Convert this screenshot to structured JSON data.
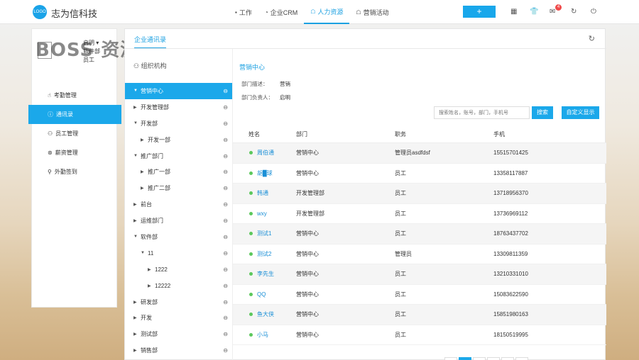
{
  "app": {
    "logo_text": "LOGO",
    "brand": "志为信科技",
    "watermark": "BOSS 资源"
  },
  "nav": [
    {
      "label": "工作",
      "icon": "briefcase-icon",
      "glyph": "▪"
    },
    {
      "label": "企业CRM",
      "icon": "pie-chart-icon",
      "glyph": "◔"
    },
    {
      "label": "人力资源",
      "icon": "people-icon",
      "glyph": "☖",
      "active": true
    },
    {
      "label": "营销活动",
      "icon": "megaphone-icon",
      "glyph": "☖"
    }
  ],
  "topbar": {
    "plus_label": "+",
    "mail_badge": "4"
  },
  "user": {
    "name": "启明",
    "dept": "软件部",
    "role": "员工"
  },
  "left_menu": [
    {
      "label": "考勤管理",
      "icon": "hand-icon",
      "glyph": "☝"
    },
    {
      "label": "通讯录",
      "icon": "info-icon",
      "glyph": "ⓘ",
      "active": true
    },
    {
      "label": "员工管理",
      "icon": "user-card-icon",
      "glyph": "⚇"
    },
    {
      "label": "薪资管理",
      "icon": "coin-icon",
      "glyph": "⊛"
    },
    {
      "label": "外勤签到",
      "icon": "location-pin-icon",
      "glyph": "⚲"
    }
  ],
  "main": {
    "tab_label": "企业通讯录",
    "tree_header": "组织机构",
    "dept_title": "营销中心",
    "dept_desc_label": "部门描述：",
    "dept_desc_value": "营销",
    "dept_head_label": "部门负责人：",
    "dept_head_value": "启明",
    "search_placeholder": "搜索姓名，账号，部门，手机号",
    "search_button": "搜索",
    "custom_button": "自定义显示"
  },
  "tree": [
    {
      "label": "营销中心",
      "level": 0,
      "expanded": true,
      "active": true
    },
    {
      "label": "开发管理部",
      "level": 0,
      "expanded": false
    },
    {
      "label": "开发部",
      "level": 0,
      "expanded": true
    },
    {
      "label": "开发一部",
      "level": 1,
      "expanded": false
    },
    {
      "label": "推广部门",
      "level": 0,
      "expanded": true
    },
    {
      "label": "推广一部",
      "level": 1,
      "expanded": false
    },
    {
      "label": "推广二部",
      "level": 1,
      "expanded": false
    },
    {
      "label": "前台",
      "level": 0,
      "expanded": false
    },
    {
      "label": "运维部门",
      "level": 0,
      "expanded": false
    },
    {
      "label": "软件部",
      "level": 0,
      "expanded": true
    },
    {
      "label": "11",
      "level": 1,
      "expanded": true
    },
    {
      "label": "1222",
      "level": 2,
      "expanded": false
    },
    {
      "label": "12222",
      "level": 2,
      "expanded": false
    },
    {
      "label": "研发部",
      "level": 0,
      "expanded": false
    },
    {
      "label": "开发",
      "level": 0,
      "expanded": false
    },
    {
      "label": "测试部",
      "level": 0,
      "expanded": false
    },
    {
      "label": "销售部",
      "level": 0,
      "expanded": false
    }
  ],
  "table": {
    "headers": [
      "姓名",
      "部门",
      "职务",
      "手机"
    ],
    "rows": [
      [
        "周伯通",
        "营销中心",
        "管理员asdfdsf",
        "15515701425"
      ],
      [
        "胡█球",
        "营销中心",
        "员工",
        "13358117887"
      ],
      [
        "韩通",
        "开发管理部",
        "员工",
        "13718956370"
      ],
      [
        "wxy",
        "开发管理部",
        "员工",
        "13736969112"
      ],
      [
        "测试1",
        "营销中心",
        "员工",
        "18763437702"
      ],
      [
        "测试2",
        "营销中心",
        "管理员",
        "13309811359"
      ],
      [
        "李先生",
        "营销中心",
        "员工",
        "13210331010"
      ],
      [
        "QQ",
        "营销中心",
        "员工",
        "15083622590"
      ],
      [
        "鱼大侠",
        "营销中心",
        "员工",
        "15851980163"
      ],
      [
        "小马",
        "营销中心",
        "员工",
        "18150519995"
      ]
    ]
  }
}
